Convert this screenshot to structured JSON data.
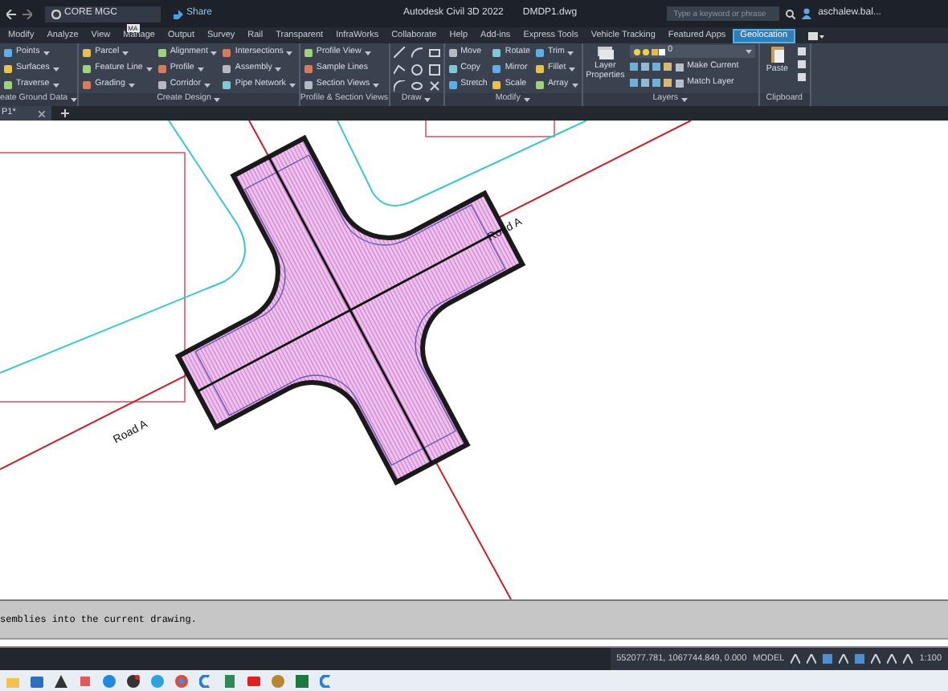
{
  "title_bar": {
    "workspace": "CORE MGC",
    "share": "Share",
    "app_title": "Autodesk Civil 3D 2022",
    "file_name": "DMDP1.dwg",
    "search": {
      "placeholder": "Type a keyword or phrase"
    },
    "user": "aschalew.bal..."
  },
  "keytip": "MA",
  "ribbon_tabs": [
    {
      "label": "Modify",
      "selected": false
    },
    {
      "label": "Analyze",
      "selected": false
    },
    {
      "label": "View",
      "selected": false
    },
    {
      "label": "Manage",
      "selected": false
    },
    {
      "label": "Output",
      "selected": false
    },
    {
      "label": "Survey",
      "selected": false
    },
    {
      "label": "Rail",
      "selected": false
    },
    {
      "label": "Transparent",
      "selected": false
    },
    {
      "label": "InfraWorks",
      "selected": false
    },
    {
      "label": "Collaborate",
      "selected": false
    },
    {
      "label": "Help",
      "selected": false
    },
    {
      "label": "Add-ins",
      "selected": false
    },
    {
      "label": "Express Tools",
      "selected": false
    },
    {
      "label": "Vehicle Tracking",
      "selected": false
    },
    {
      "label": "Featured Apps",
      "selected": false
    },
    {
      "label": "Geolocation",
      "selected": true
    }
  ],
  "ribbon_panels": [
    {
      "kind": "columns",
      "title": "eate Ground Data",
      "menu": true,
      "columns": [
        [
          {
            "label": "Points",
            "dropdown": true
          },
          {
            "label": "Surfaces",
            "dropdown": true
          },
          {
            "label": "Traverse",
            "dropdown": true
          }
        ]
      ]
    },
    {
      "kind": "columns",
      "title": "Create Design",
      "menu": true,
      "columns": [
        [
          {
            "label": "Parcel",
            "dropdown": true
          },
          {
            "label": "Feature Line",
            "dropdown": true
          },
          {
            "label": "Grading",
            "dropdown": true
          }
        ],
        [
          {
            "label": "Alignment",
            "dropdown": true
          },
          {
            "label": "Profile",
            "dropdown": true
          },
          {
            "label": "Corridor",
            "dropdown": true
          }
        ],
        [
          {
            "label": "Intersections",
            "dropdown": true
          },
          {
            "label": "Assembly",
            "dropdown": true
          },
          {
            "label": "Pipe Network",
            "dropdown": true
          }
        ]
      ]
    },
    {
      "kind": "columns",
      "title": "Profile & Section Views",
      "menu": false,
      "columns": [
        [
          {
            "label": "Profile View",
            "dropdown": true
          },
          {
            "label": "Sample Lines",
            "dropdown": false
          },
          {
            "label": "Section Views",
            "dropdown": true
          }
        ]
      ]
    },
    {
      "kind": "draw",
      "title": "Draw",
      "menu": true
    },
    {
      "kind": "columns",
      "title": "Modify",
      "menu": true,
      "columns": [
        [
          {
            "label": "Move",
            "dropdown": false
          },
          {
            "label": "Copy",
            "dropdown": false
          },
          {
            "label": "Stretch",
            "dropdown": false
          }
        ],
        [
          {
            "label": "Rotate",
            "dropdown": false
          },
          {
            "label": "Mirror",
            "dropdown": false
          },
          {
            "label": "Scale",
            "dropdown": false
          }
        ],
        [
          {
            "label": "Trim",
            "dropdown": true
          },
          {
            "label": "Fillet",
            "dropdown": true
          },
          {
            "label": "Array",
            "dropdown": true
          }
        ]
      ]
    },
    {
      "kind": "layers",
      "title": "Layers",
      "menu": true,
      "large_button": "Layer Properties",
      "current_layer": "0",
      "buttons": [
        "Make Current",
        "Match Layer"
      ]
    },
    {
      "kind": "clipboard",
      "title": "Clipboard",
      "menu": false,
      "large_button": "Paste"
    }
  ],
  "file_tabs": [
    {
      "label": "P1*",
      "selected": true
    }
  ],
  "drawing": {
    "labels": [
      {
        "text": "Road A"
      },
      {
        "text": "Road A"
      }
    ]
  },
  "command_line": {
    "history": "semblies into the current drawing."
  },
  "status_bar": {
    "coordinates": "552077.781, 1067744.849, 0.000",
    "space": "MODEL",
    "scale": "1:100"
  }
}
